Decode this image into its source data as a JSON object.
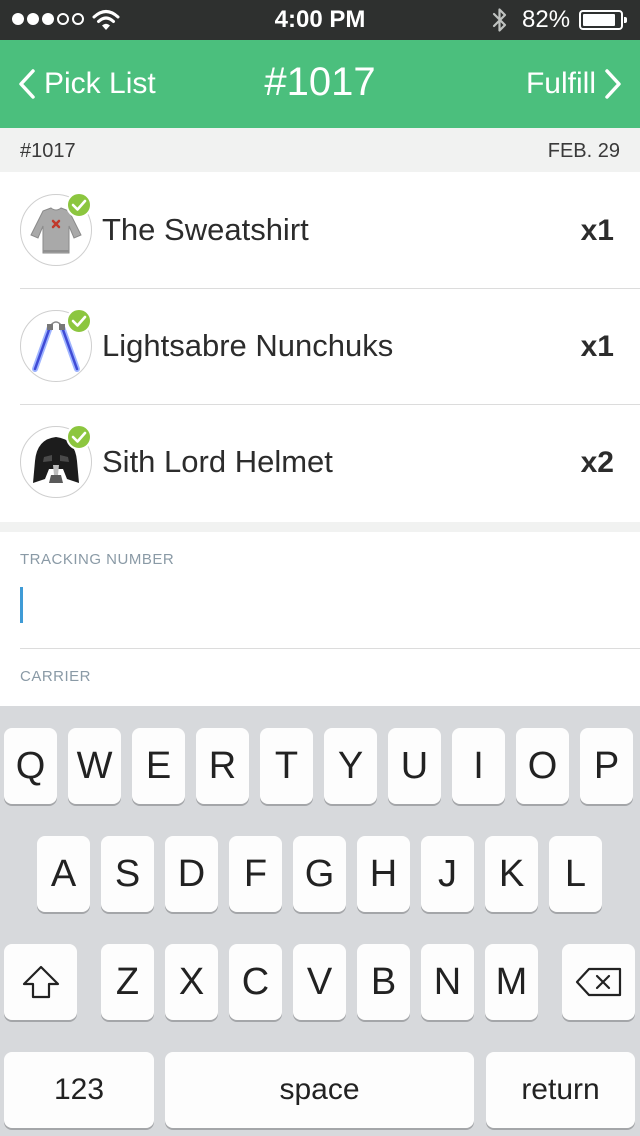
{
  "status_bar": {
    "signal_filled": 3,
    "signal_total": 5,
    "time": "4:00 PM",
    "battery_percent": "82%",
    "battery_level": 0.82
  },
  "nav": {
    "back_label": "Pick List",
    "title": "#1017",
    "forward_label": "Fulfill"
  },
  "order": {
    "number": "#1017",
    "date": "FEB. 29"
  },
  "items": [
    {
      "name": "The Sweatshirt",
      "qty": "x1",
      "image_icon": "sweatshirt-icon",
      "checked": true
    },
    {
      "name": "Lightsabre Nunchuks",
      "qty": "x1",
      "image_icon": "nunchuks-icon",
      "checked": true
    },
    {
      "name": "Sith Lord Helmet",
      "qty": "x2",
      "image_icon": "helmet-icon",
      "checked": true
    }
  ],
  "form": {
    "tracking_label": "TRACKING NUMBER",
    "tracking_value": "",
    "carrier_label": "CARRIER"
  },
  "keyboard": {
    "row1": [
      "Q",
      "W",
      "E",
      "R",
      "T",
      "Y",
      "U",
      "I",
      "O",
      "P"
    ],
    "row2": [
      "A",
      "S",
      "D",
      "F",
      "G",
      "H",
      "J",
      "K",
      "L"
    ],
    "row3": [
      "Z",
      "X",
      "C",
      "V",
      "B",
      "N",
      "M"
    ],
    "numbers_label": "123",
    "space_label": "space",
    "return_label": "return"
  },
  "colors": {
    "accent_green": "#4bbf7d",
    "check_green": "#8cc63f",
    "cursor_blue": "#3f9bd6",
    "status_bar_bg": "#2e302f"
  }
}
